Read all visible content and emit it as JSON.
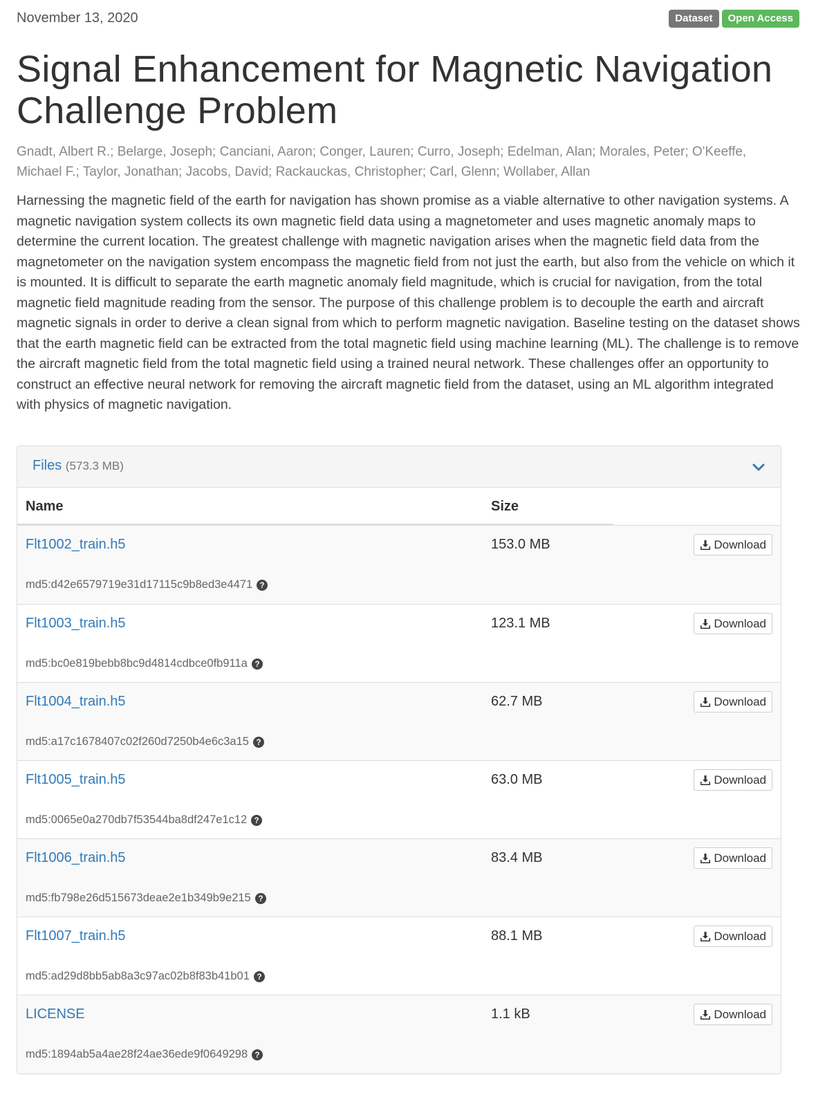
{
  "record": {
    "publication_date": "November 13, 2020",
    "badges": {
      "type": "Dataset",
      "access": "Open Access"
    },
    "title": "Signal Enhancement for Magnetic Navigation Challenge Problem",
    "authors": "Gnadt, Albert R.; Belarge, Joseph; Canciani, Aaron; Conger, Lauren; Curro, Joseph; Edelman, Alan; Morales, Peter; O'Keeffe, Michael F.; Taylor, Jonathan; Jacobs, David; Rackauckas, Christopher; Carl, Glenn; Wollaber, Allan",
    "description": "Harnessing the magnetic field of the earth for navigation has shown promise as a viable alternative to other navigation systems. A magnetic navigation system collects its own magnetic field data using a magnetometer and uses magnetic anomaly maps to determine the current location. The greatest challenge with magnetic navigation arises when the magnetic field data from the magnetometer on the navigation system encompass the magnetic field from not just the earth, but also from the vehicle on which it is mounted. It is difficult to separate the earth magnetic anomaly field magnitude, which is crucial for navigation, from the total magnetic field magnitude reading from the sensor. The purpose of this challenge problem is to decouple the earth and aircraft magnetic signals in order to derive a clean signal from which to perform magnetic navigation. Baseline testing on the dataset shows that the earth magnetic field can be extracted from the total magnetic field using machine learning (ML). The challenge is to remove the aircraft magnetic field from the total magnetic field using a trained neural network. These challenges offer an opportunity to construct an effective neural network for removing the aircraft magnetic field from the dataset, using an ML algorithm integrated with physics of magnetic navigation."
  },
  "files_panel": {
    "title": "Files",
    "total_size": "(573.3 MB)",
    "columns": {
      "name": "Name",
      "size": "Size"
    },
    "download_label": "Download",
    "files": [
      {
        "name": "Flt1002_train.h5",
        "size": "153.0 MB",
        "checksum": "md5:d42e6579719e31d17115c9b8ed3e4471"
      },
      {
        "name": "Flt1003_train.h5",
        "size": "123.1 MB",
        "checksum": "md5:bc0e819bebb8bc9d4814cdbce0fb911a"
      },
      {
        "name": "Flt1004_train.h5",
        "size": "62.7 MB",
        "checksum": "md5:a17c1678407c02f260d7250b4e6c3a15"
      },
      {
        "name": "Flt1005_train.h5",
        "size": "63.0 MB",
        "checksum": "md5:0065e0a270db7f53544ba8df247e1c12"
      },
      {
        "name": "Flt1006_train.h5",
        "size": "83.4 MB",
        "checksum": "md5:fb798e26d515673deae2e1b349b9e215"
      },
      {
        "name": "Flt1007_train.h5",
        "size": "88.1 MB",
        "checksum": "md5:ad29d8bb5ab8a3c97ac02b8f83b41b01"
      },
      {
        "name": "LICENSE",
        "size": "1.1 kB",
        "checksum": "md5:1894ab5a4ae28f24ae36ede9f0649298"
      }
    ]
  },
  "colors": {
    "link": "#337ab7",
    "badge_type": "#777777",
    "badge_access": "#5cb85c"
  },
  "icons": {
    "collapse": "chevron-down-icon",
    "download": "download-icon",
    "checksum_help": "question-circle-icon"
  }
}
